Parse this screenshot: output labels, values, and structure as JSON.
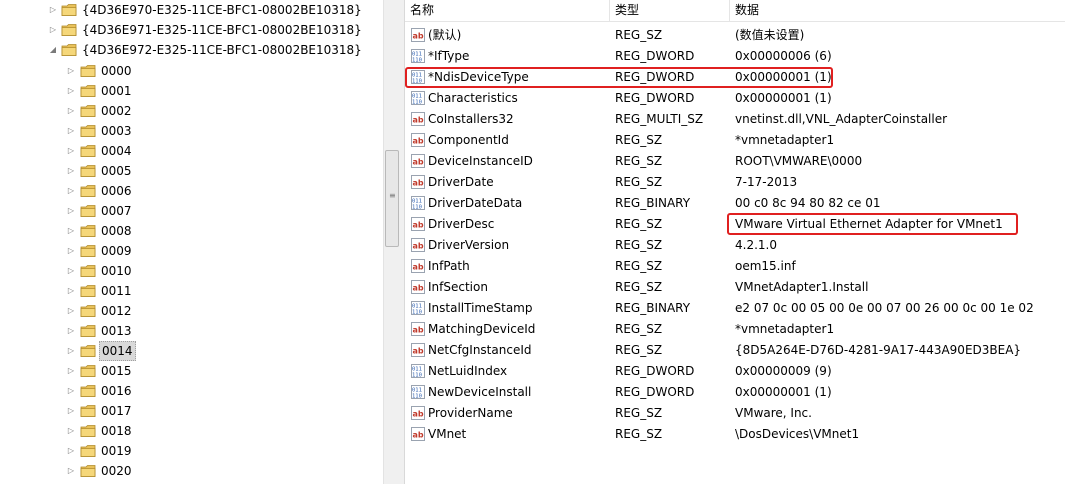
{
  "tree": {
    "guid_nodes": [
      {
        "label": "{4D36E970-E325-11CE-BFC1-08002BE10318}",
        "expanded": false
      },
      {
        "label": "{4D36E971-E325-11CE-BFC1-08002BE10318}",
        "expanded": false
      },
      {
        "label": "{4D36E972-E325-11CE-BFC1-08002BE10318}",
        "expanded": true
      }
    ],
    "child_nodes": [
      "0000",
      "0001",
      "0002",
      "0003",
      "0004",
      "0005",
      "0006",
      "0007",
      "0008",
      "0009",
      "0010",
      "0011",
      "0012",
      "0013",
      "0014",
      "0015",
      "0016",
      "0017",
      "0018",
      "0019",
      "0020"
    ],
    "selected": "0014"
  },
  "list": {
    "columns": {
      "name": "名称",
      "type": "类型",
      "data": "数据"
    },
    "rows": [
      {
        "icon": "ab",
        "name": "(默认)",
        "type": "REG_SZ",
        "data": "(数值未设置)"
      },
      {
        "icon": "bin",
        "name": "*IfType",
        "type": "REG_DWORD",
        "data": "0x00000006 (6)"
      },
      {
        "icon": "bin",
        "name": "*NdisDeviceType",
        "type": "REG_DWORD",
        "data": "0x00000001 (1)"
      },
      {
        "icon": "bin",
        "name": "Characteristics",
        "type": "REG_DWORD",
        "data": "0x00000001 (1)"
      },
      {
        "icon": "ab",
        "name": "CoInstallers32",
        "type": "REG_MULTI_SZ",
        "data": "vnetinst.dll,VNL_AdapterCoinstaller"
      },
      {
        "icon": "ab",
        "name": "ComponentId",
        "type": "REG_SZ",
        "data": "*vmnetadapter1"
      },
      {
        "icon": "ab",
        "name": "DeviceInstanceID",
        "type": "REG_SZ",
        "data": "ROOT\\VMWARE\\0000"
      },
      {
        "icon": "ab",
        "name": "DriverDate",
        "type": "REG_SZ",
        "data": "7-17-2013"
      },
      {
        "icon": "bin",
        "name": "DriverDateData",
        "type": "REG_BINARY",
        "data": "00 c0 8c 94 80 82 ce 01"
      },
      {
        "icon": "ab",
        "name": "DriverDesc",
        "type": "REG_SZ",
        "data": "VMware Virtual Ethernet Adapter for VMnet1"
      },
      {
        "icon": "ab",
        "name": "DriverVersion",
        "type": "REG_SZ",
        "data": "4.2.1.0"
      },
      {
        "icon": "ab",
        "name": "InfPath",
        "type": "REG_SZ",
        "data": "oem15.inf"
      },
      {
        "icon": "ab",
        "name": "InfSection",
        "type": "REG_SZ",
        "data": "VMnetAdapter1.Install"
      },
      {
        "icon": "bin",
        "name": "InstallTimeStamp",
        "type": "REG_BINARY",
        "data": "e2 07 0c 00 05 00 0e 00 07 00 26 00 0c 00 1e 02"
      },
      {
        "icon": "ab",
        "name": "MatchingDeviceId",
        "type": "REG_SZ",
        "data": "*vmnetadapter1"
      },
      {
        "icon": "ab",
        "name": "NetCfgInstanceId",
        "type": "REG_SZ",
        "data": "{8D5A264E-D76D-4281-9A17-443A90ED3BEA}"
      },
      {
        "icon": "bin",
        "name": "NetLuidIndex",
        "type": "REG_DWORD",
        "data": "0x00000009 (9)"
      },
      {
        "icon": "bin",
        "name": "NewDeviceInstall",
        "type": "REG_DWORD",
        "data": "0x00000001 (1)"
      },
      {
        "icon": "ab",
        "name": "ProviderName",
        "type": "REG_SZ",
        "data": "VMware, Inc."
      },
      {
        "icon": "ab",
        "name": "VMnet",
        "type": "REG_SZ",
        "data": "\\DosDevices\\VMnet1"
      }
    ]
  },
  "colors": {
    "highlight": "#e02020",
    "folder": "#e8c15a",
    "ab_icon": "#c0392b",
    "bin_icon": "#2b5fb0"
  }
}
